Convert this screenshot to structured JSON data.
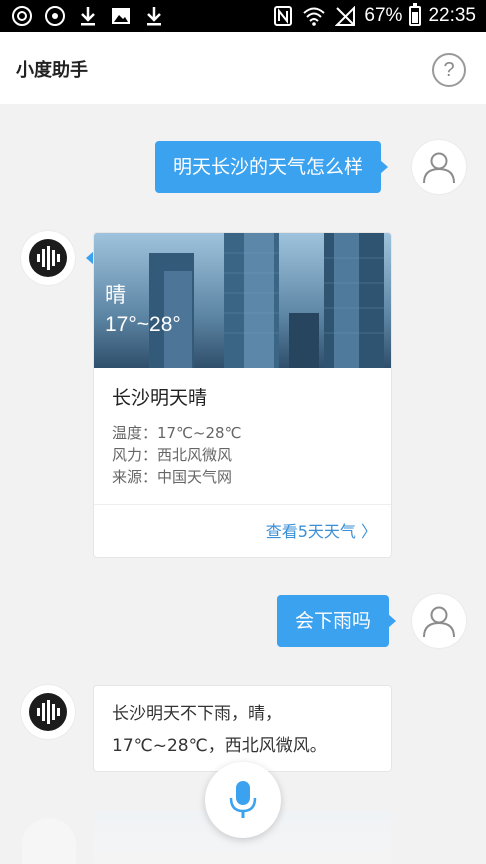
{
  "status_bar": {
    "battery": "67%",
    "time": "22:35",
    "battery_level": 0.67
  },
  "header": {
    "title": "小度助手",
    "help_label": "?"
  },
  "chat": {
    "user_msg_1": "明天长沙的天气怎么样",
    "weather_card": {
      "image_condition": "晴",
      "image_temp": "17°~28°",
      "title": "长沙明天晴",
      "temperature_line": "温度：17℃~28℃",
      "wind_line": "风力：西北风微风",
      "source_line": "来源：中国天气网",
      "more_link": "查看5天天气 〉"
    },
    "user_msg_2": "会下雨吗",
    "bot_reply_line1": "长沙明天不下雨，晴，",
    "bot_reply_line2": "17℃~28℃，西北风微风。"
  },
  "colors": {
    "accent": "#3ba2f0",
    "link": "#3a8fd6"
  }
}
